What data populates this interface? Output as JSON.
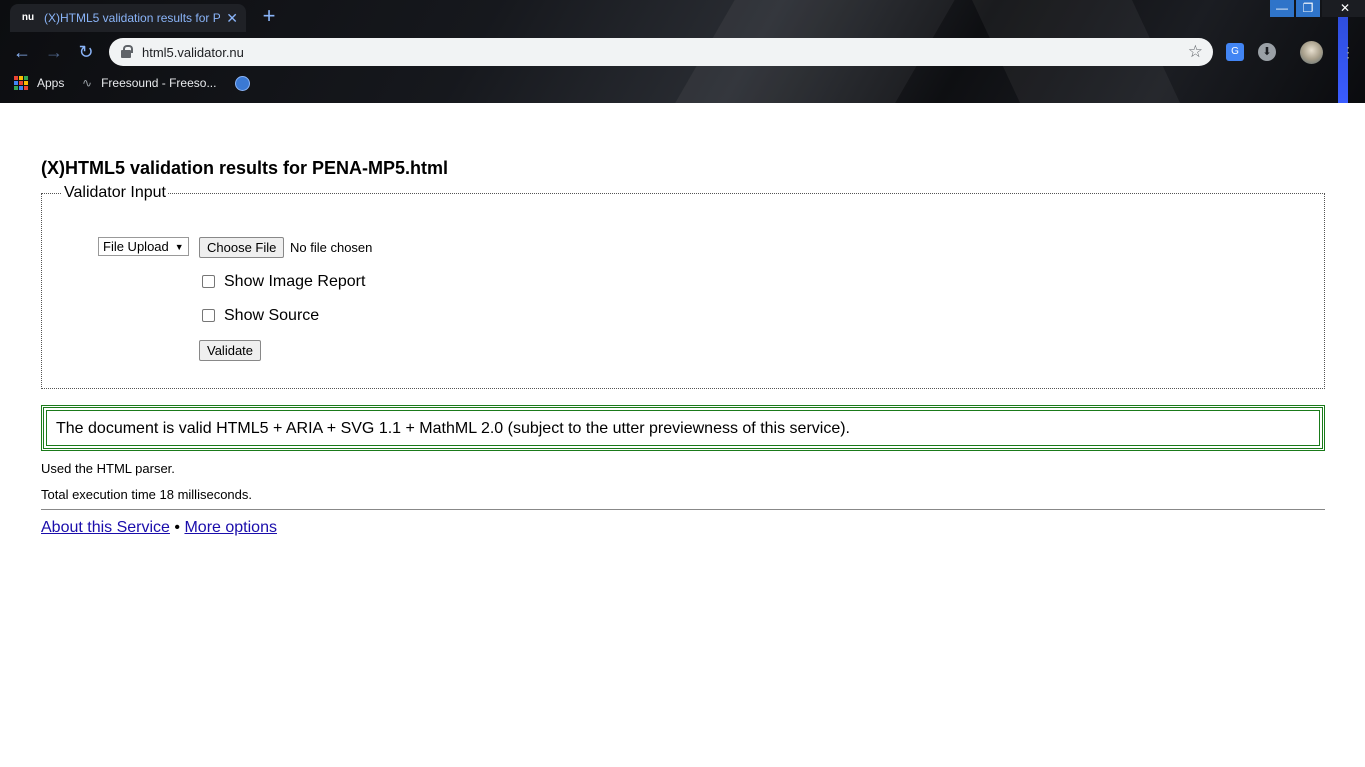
{
  "browser": {
    "tab_title": "(X)HTML5 validation results for P",
    "tab_favicon": "nu",
    "tab_close": "✕",
    "new_tab": "+",
    "url": "html5.validator.nu",
    "window_controls": {
      "minimize": "—",
      "maximize": "❐",
      "close": "✕"
    },
    "bookmarks": [
      {
        "label": "Apps",
        "icon": "apps-grid-icon"
      },
      {
        "label": "Freesound - Freeso...",
        "icon": "waveform-icon"
      },
      {
        "label": "",
        "icon": "globe-icon"
      }
    ],
    "accent": "#8ab4f8"
  },
  "page": {
    "heading": "(X)HTML5 validation results for PENA-MP5.html",
    "legend": "Validator Input",
    "input_mode": "File Upload",
    "choose_file_label": "Choose File",
    "no_file_text": "No file chosen",
    "show_image_report_label": "Show Image Report",
    "show_image_report_checked": false,
    "show_source_label": "Show Source",
    "show_source_checked": false,
    "validate_label": "Validate",
    "success_message": "The document is valid HTML5 + ARIA + SVG 1.1 + MathML 2.0 (subject to the utter previewness of this service).",
    "parser_info": "Used the HTML parser.",
    "execution_info": "Total execution time 18 milliseconds.",
    "footer_link_about": "About this Service",
    "footer_separator": "•",
    "footer_link_options": "More options",
    "success_color": "#1a7a1a"
  }
}
